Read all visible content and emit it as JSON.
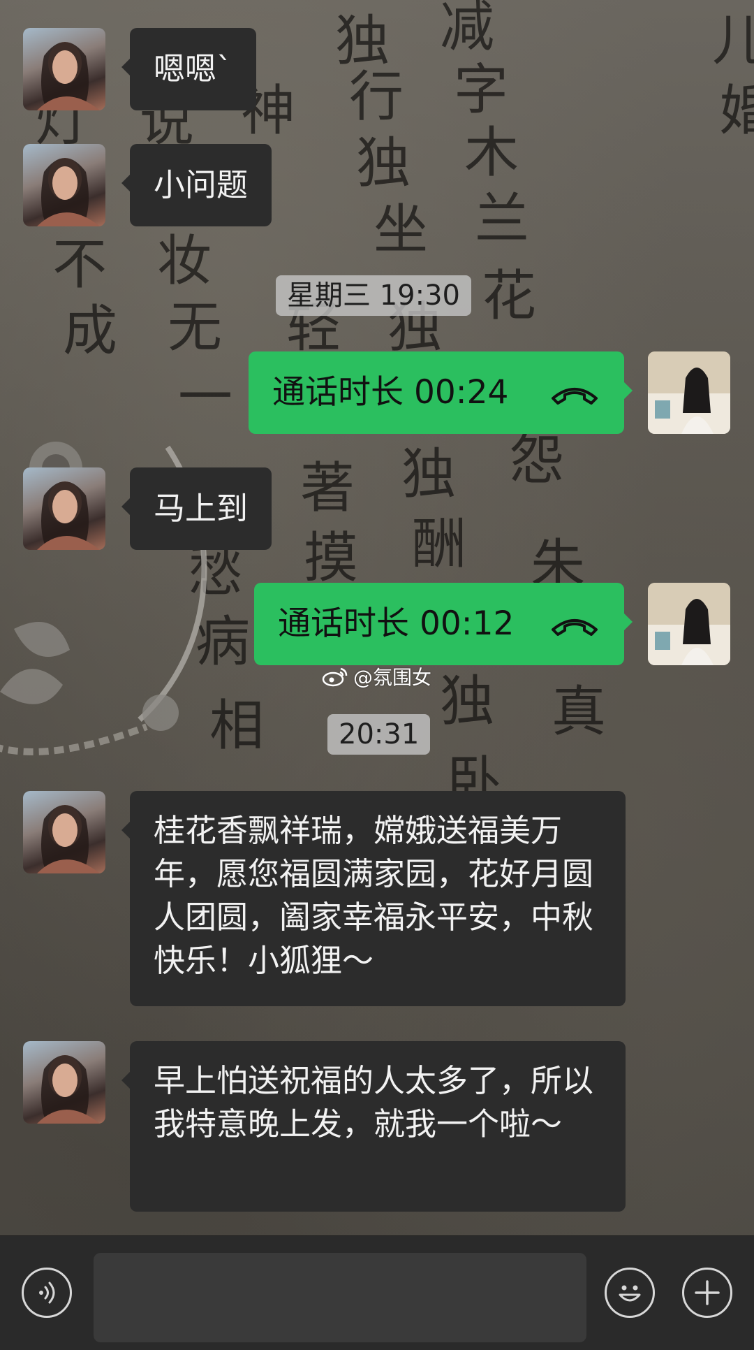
{
  "background": {
    "glyphs": [
      "独",
      "减",
      "儿",
      "灯",
      "说",
      "神",
      "行",
      "字",
      "婚",
      "独",
      "木",
      "不",
      "妆",
      "坐",
      "兰",
      "花",
      "成",
      "无",
      "轻",
      "独",
      "一",
      "著",
      "独",
      "怨",
      "摸",
      "酬",
      "朱",
      "独",
      "真",
      "相",
      "卧",
      "愁",
      "病"
    ]
  },
  "messages": [
    {
      "side": "in",
      "text": "嗯嗯`"
    },
    {
      "side": "in",
      "text": "小问题"
    },
    {
      "side": "timestamp",
      "text": "星期三 19:30"
    },
    {
      "side": "out",
      "type": "call",
      "text": "通话时长 00:24"
    },
    {
      "side": "in",
      "text": "马上到"
    },
    {
      "side": "out",
      "type": "call",
      "text": "通话时长 00:12"
    },
    {
      "side": "timestamp",
      "text": "20:31"
    },
    {
      "side": "in",
      "text": "桂花香飘祥瑞，嫦娥送福美万年，愿您福圆满家园，花好月圆人团圆，阖家幸福永平安，中秋快乐！小狐狸～"
    },
    {
      "side": "in",
      "text": "早上怕送祝福的人太多了，所以我特意晚上发，就我一个啦～"
    }
  ],
  "watermark": {
    "text": "@氛围女"
  },
  "input_bar": {
    "voice_icon": "voice-icon",
    "emoji_icon": "emoji-icon",
    "plus_icon": "plus-icon",
    "input_value": ""
  },
  "colors": {
    "outgoing_bubble": "#2bbf5f",
    "incoming_bubble": "#2c2c2c",
    "input_bar": "#2a2a2a"
  }
}
